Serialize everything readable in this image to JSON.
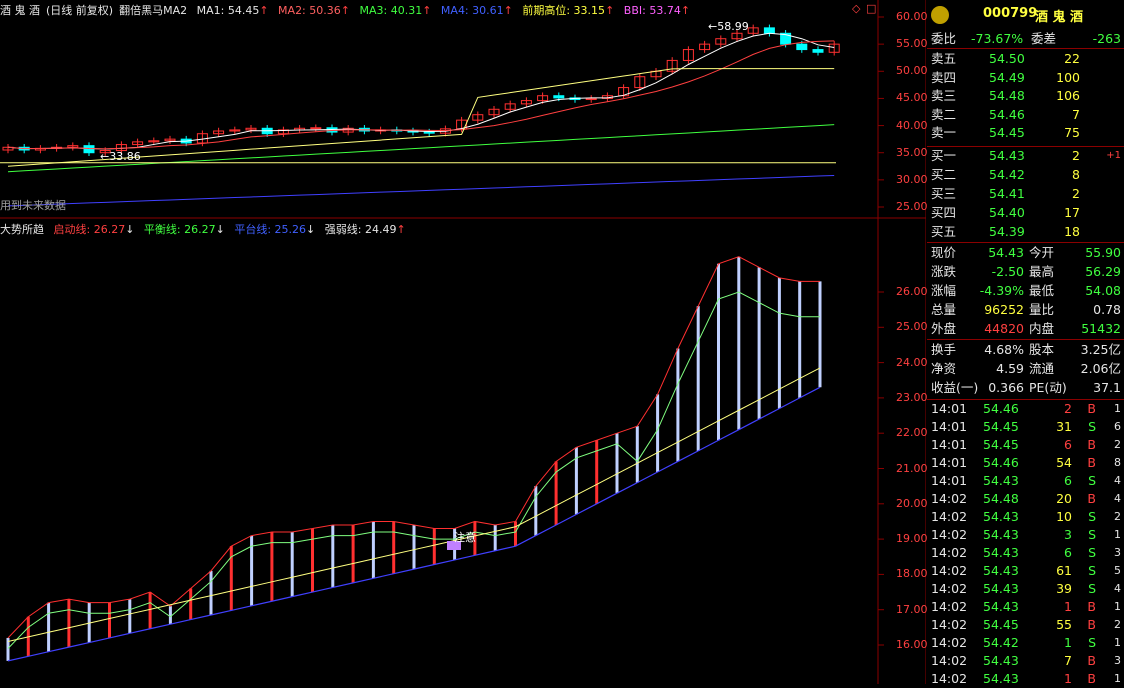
{
  "main_indicator": {
    "stock_name": "酒 鬼 酒",
    "period_label": "(日线 前复权)",
    "formula": "翻倍黑马MA2",
    "ma1": "MA1: 54.45",
    "ma2": "MA2: 50.36",
    "ma3": "MA3: 40.31",
    "ma4": "MA4: 30.61",
    "prev_high": "前期高位: 33.15",
    "bbi": "BBI: 53.74",
    "arrow": "↑",
    "future_note": "用到未来数据",
    "high_label": "58.99",
    "low_label": "33.86",
    "price_ticks": [
      "60.00",
      "55.00",
      "50.00",
      "45.00",
      "40.00",
      "35.00",
      "30.00",
      "25.00"
    ]
  },
  "sub_indicator": {
    "name": "大势所趋",
    "start_line": "启动线: 26.27",
    "balance_line": "平衡线: 26.27",
    "platform_line": "平台线: 25.26",
    "strength_line": "强弱线: 24.49",
    "down_arrow": "↓",
    "up_arrow": "↑",
    "note": "注意",
    "ticks": [
      "26.00",
      "25.00",
      "24.00",
      "23.00",
      "22.00",
      "21.00",
      "20.00",
      "19.00",
      "18.00",
      "17.00",
      "16.00"
    ]
  },
  "colors": {
    "up": "#ff3030",
    "down": "#00ffff",
    "ma1": "#ffffff",
    "ma2": "#ff4040",
    "ma3": "#ffff80",
    "ma4": "#40ff40",
    "blue": "#4040ff",
    "grid": "#8b0000"
  },
  "quote": {
    "code": "000799",
    "name": "酒 鬼 酒",
    "wei_bi_label": "委比",
    "wei_bi": "-73.67%",
    "wei_cha_label": "委差",
    "wei_cha": "-263",
    "asks": [
      {
        "label": "卖五",
        "price": "54.50",
        "vol": "22"
      },
      {
        "label": "卖四",
        "price": "54.49",
        "vol": "100"
      },
      {
        "label": "卖三",
        "price": "54.48",
        "vol": "106"
      },
      {
        "label": "卖二",
        "price": "54.46",
        "vol": "7"
      },
      {
        "label": "卖一",
        "price": "54.45",
        "vol": "75"
      }
    ],
    "bids": [
      {
        "label": "买一",
        "price": "54.43",
        "vol": "2",
        "chg": "+1"
      },
      {
        "label": "买二",
        "price": "54.42",
        "vol": "8",
        "chg": ""
      },
      {
        "label": "买三",
        "price": "54.41",
        "vol": "2",
        "chg": ""
      },
      {
        "label": "买四",
        "price": "54.40",
        "vol": "17",
        "chg": ""
      },
      {
        "label": "买五",
        "price": "54.39",
        "vol": "18",
        "chg": ""
      }
    ],
    "stats": [
      {
        "l1": "现价",
        "v1": "54.43",
        "l2": "今开",
        "v2": "55.90",
        "c1": "green",
        "c2": "green"
      },
      {
        "l1": "涨跌",
        "v1": "-2.50",
        "l2": "最高",
        "v2": "56.29",
        "c1": "green",
        "c2": "green"
      },
      {
        "l1": "涨幅",
        "v1": "-4.39%",
        "l2": "最低",
        "v2": "54.08",
        "c1": "green",
        "c2": "green"
      },
      {
        "l1": "总量",
        "v1": "96252",
        "l2": "量比",
        "v2": "0.78",
        "c1": "yellow",
        "c2": "white"
      },
      {
        "l1": "外盘",
        "v1": "44820",
        "l2": "内盘",
        "v2": "51432",
        "c1": "red",
        "c2": "green"
      }
    ],
    "stats2": [
      {
        "l1": "换手",
        "v1": "4.68%",
        "l2": "股本",
        "v2": "3.25亿"
      },
      {
        "l1": "净资",
        "v1": "4.59",
        "l2": "流通",
        "v2": "2.06亿"
      },
      {
        "l1": "收益(一)",
        "v1": "0.366",
        "l2": "PE(动)",
        "v2": "37.1"
      }
    ],
    "ticks": [
      {
        "t": "14:01",
        "p": "54.46",
        "v": "2",
        "s": "B",
        "n": "1",
        "vc": "red"
      },
      {
        "t": "14:01",
        "p": "54.45",
        "v": "31",
        "s": "S",
        "n": "6",
        "vc": "yellow"
      },
      {
        "t": "14:01",
        "p": "54.45",
        "v": "6",
        "s": "B",
        "n": "2",
        "vc": "red"
      },
      {
        "t": "14:01",
        "p": "54.46",
        "v": "54",
        "s": "B",
        "n": "8",
        "vc": "yellow"
      },
      {
        "t": "14:01",
        "p": "54.43",
        "v": "6",
        "s": "S",
        "n": "4",
        "vc": "green"
      },
      {
        "t": "14:02",
        "p": "54.48",
        "v": "20",
        "s": "B",
        "n": "4",
        "vc": "yellow"
      },
      {
        "t": "14:02",
        "p": "54.43",
        "v": "10",
        "s": "S",
        "n": "2",
        "vc": "yellow"
      },
      {
        "t": "14:02",
        "p": "54.43",
        "v": "3",
        "s": "S",
        "n": "1",
        "vc": "green"
      },
      {
        "t": "14:02",
        "p": "54.43",
        "v": "6",
        "s": "S",
        "n": "3",
        "vc": "green"
      },
      {
        "t": "14:02",
        "p": "54.43",
        "v": "61",
        "s": "S",
        "n": "5",
        "vc": "yellow"
      },
      {
        "t": "14:02",
        "p": "54.43",
        "v": "39",
        "s": "S",
        "n": "4",
        "vc": "yellow"
      },
      {
        "t": "14:02",
        "p": "54.43",
        "v": "1",
        "s": "B",
        "n": "1",
        "vc": "red"
      },
      {
        "t": "14:02",
        "p": "54.45",
        "v": "55",
        "s": "B",
        "n": "2",
        "vc": "yellow"
      },
      {
        "t": "14:02",
        "p": "54.42",
        "v": "1",
        "s": "S",
        "n": "1",
        "vc": "green"
      },
      {
        "t": "14:02",
        "p": "54.43",
        "v": "7",
        "s": "B",
        "n": "3",
        "vc": "yellow"
      },
      {
        "t": "14:02",
        "p": "54.43",
        "v": "1",
        "s": "B",
        "n": "1",
        "vc": "red"
      }
    ]
  }
}
